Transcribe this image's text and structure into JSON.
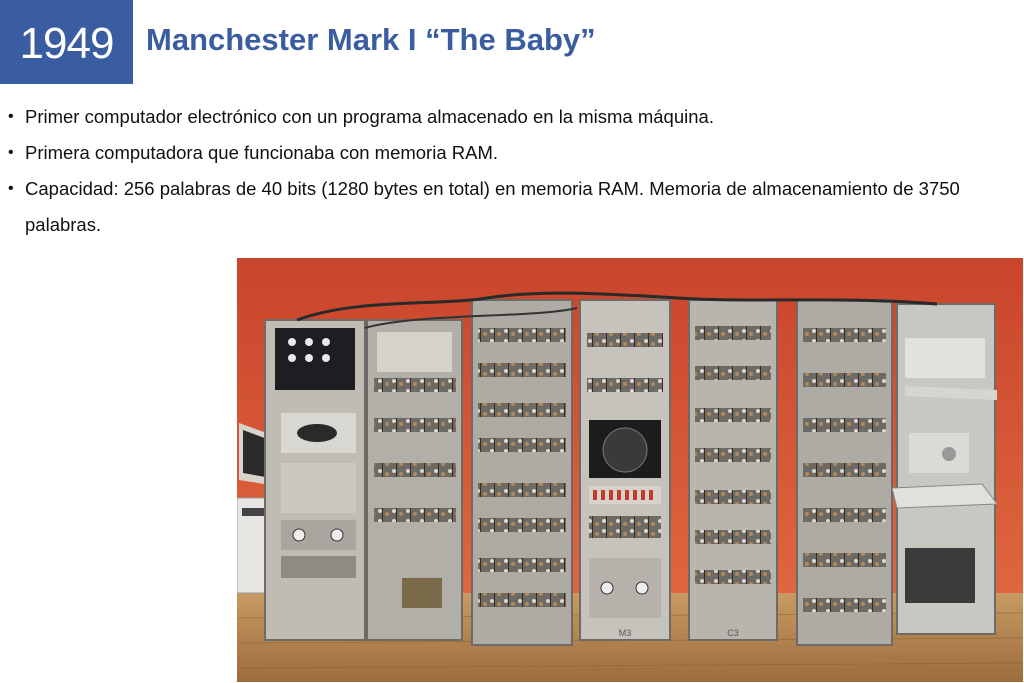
{
  "header": {
    "year": "1949",
    "title": "Manchester Mark I “The Baby”"
  },
  "bullets": [
    "Primer computador electrónico con un programa almacenado en la misma máquina.",
    "Primera computadora que funcionaba con memoria RAM.",
    "Capacidad: 256 palabras de 40 bits (1280 bytes en total) en memoria RAM. Memoria de almacenamiento de 3750 palabras."
  ],
  "photo": {
    "rack_labels": [
      "M3",
      "C3"
    ]
  },
  "colors": {
    "accent": "#3a5ca0",
    "wall": "#d9553a",
    "floor": "#b98a55"
  }
}
